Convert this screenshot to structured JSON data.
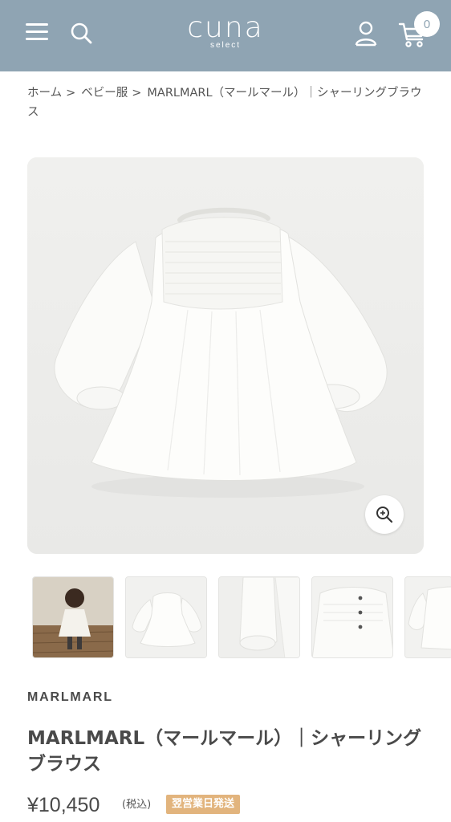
{
  "header": {
    "logo_main": "cuna",
    "logo_sub": "select",
    "cart_count": "0",
    "bg_color": "#8fa4b3"
  },
  "breadcrumb": {
    "items": [
      "ホーム",
      "ベビー服"
    ],
    "current": "MARLMARL（マールマール）｜シャーリングブラウス",
    "separator": ">"
  },
  "gallery": {
    "main_image": "white-shirred-blouse-photo",
    "zoom_icon": "magnifier-plus-icon",
    "thumbnails": [
      {
        "name": "child-wearing-blouse-photo"
      },
      {
        "name": "blouse-front-photo"
      },
      {
        "name": "sleeve-cuff-detail-photo"
      },
      {
        "name": "back-button-detail-photo"
      },
      {
        "name": "blouse-partial-photo"
      }
    ]
  },
  "product": {
    "brand": "MARLMARL",
    "title": "MARLMARL（マールマール）｜シャーリングブラウス",
    "price": "¥10,450",
    "tax_note": "(税込)",
    "shipping_badge": "翌営業日発送",
    "badge_color": "#e2b47d"
  }
}
